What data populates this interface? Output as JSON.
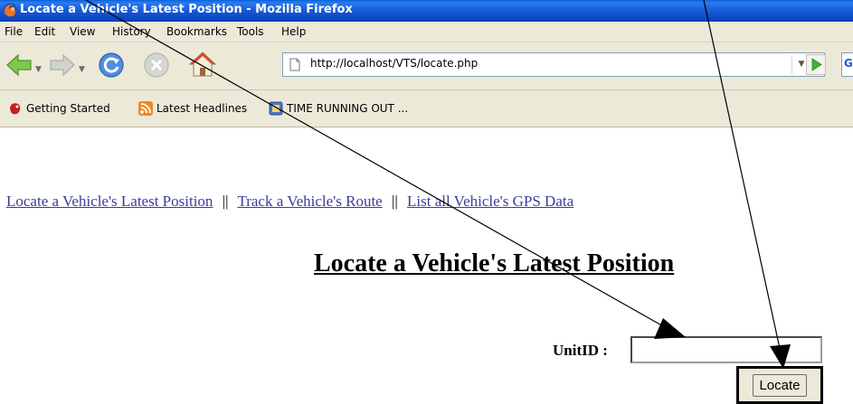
{
  "window": {
    "title": "Locate a Vehicle's Latest Position - Mozilla Firefox",
    "app_icon": "firefox-icon"
  },
  "menu": {
    "file": "File",
    "edit": "Edit",
    "view": "View",
    "history": "History",
    "bookmarks": "Bookmarks",
    "tools": "Tools",
    "help": "Help"
  },
  "navigation": {
    "back_icon": "back-arrow-icon",
    "forward_icon": "forward-arrow-icon",
    "reload_icon": "reload-icon",
    "stop_icon": "stop-icon",
    "home_icon": "home-icon",
    "url": "http://localhost/VTS/locate.php",
    "go_icon": "go-arrow-icon"
  },
  "bookmarks": [
    {
      "label": "Getting Started",
      "icon": "getting-started-icon"
    },
    {
      "label": "Latest Headlines",
      "icon": "rss-feed-icon"
    },
    {
      "label": "TIME RUNNING OUT ...",
      "icon": "bookmark-page-icon"
    }
  ],
  "page": {
    "links": {
      "locate": "Locate a Vehicle's Latest Position",
      "sep1": "||",
      "track": "Track a Vehicle's Route",
      "sep2": "||",
      "list": "List all Vehicle's GPS Data"
    },
    "heading": "Locate a Vehicle's Latest Position",
    "unit_label": "UnitID :",
    "unit_value": "",
    "locate_button": "Locate"
  },
  "colors": {
    "titlebar": "#0b46c3",
    "chrome": "#ece9d8",
    "link": "#3b3b9e"
  }
}
